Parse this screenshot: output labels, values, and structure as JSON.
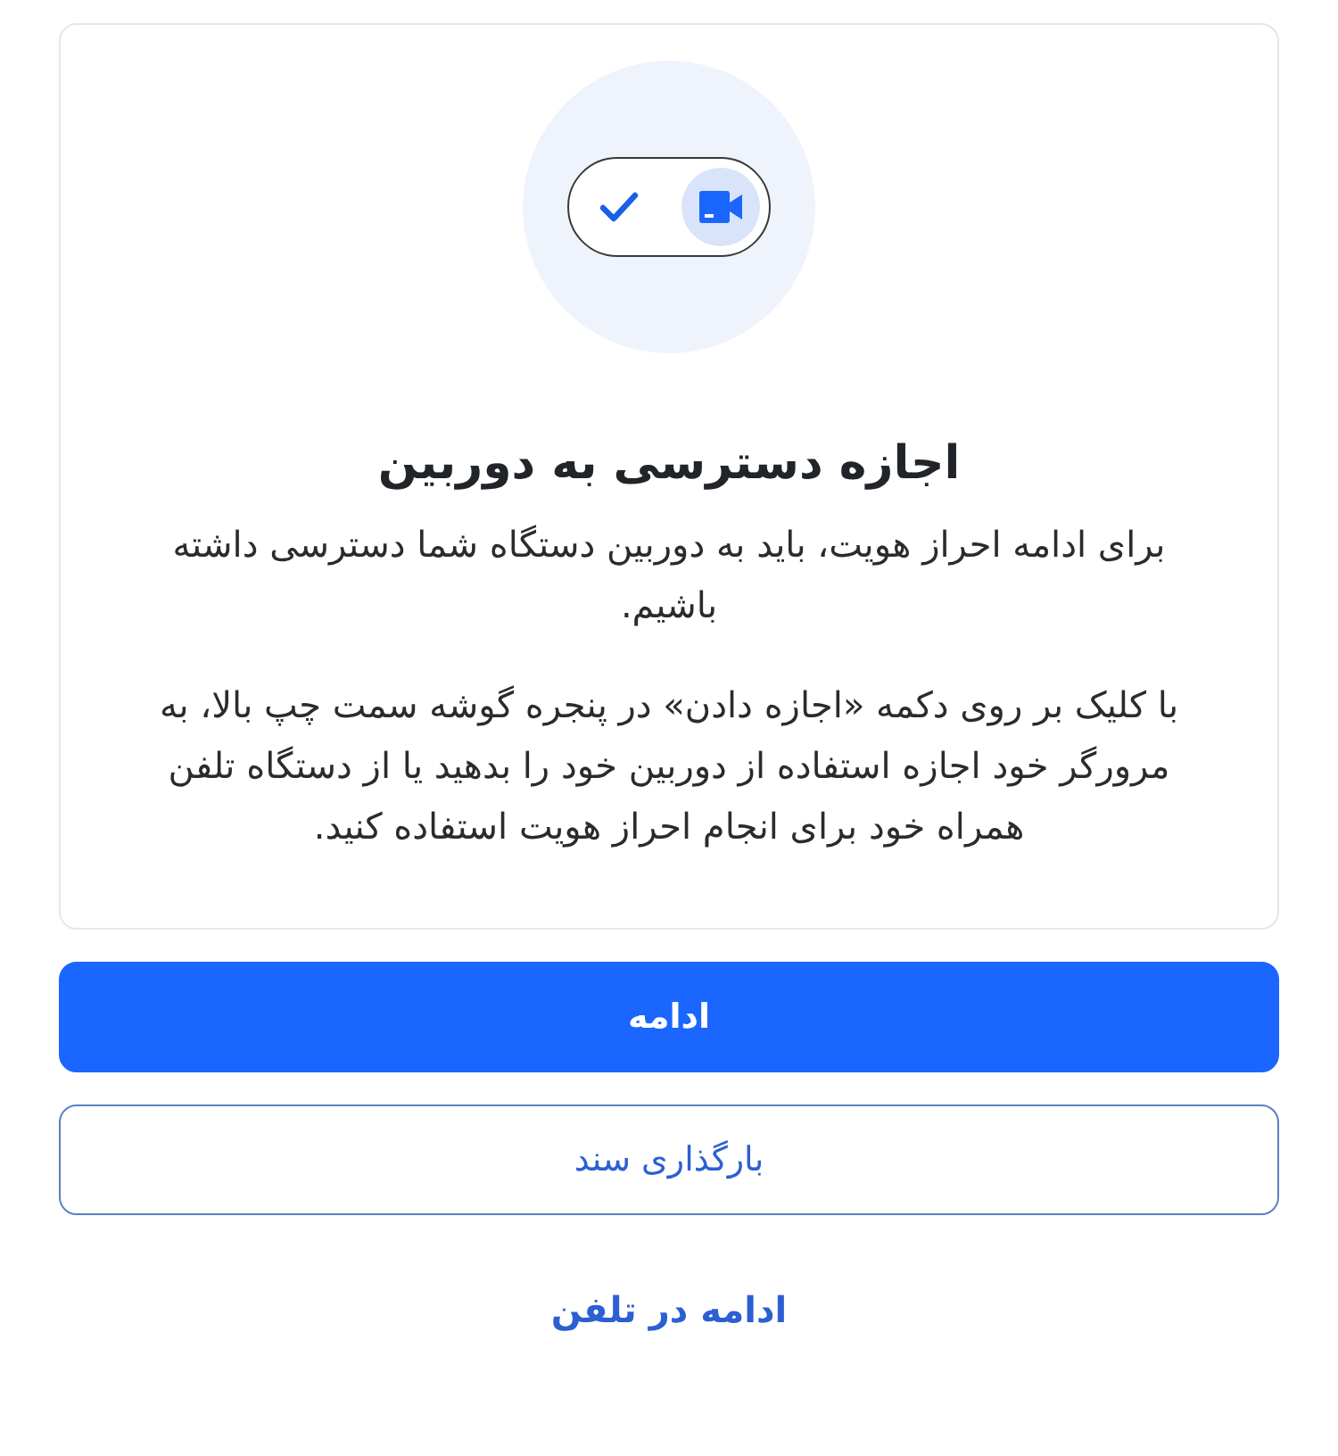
{
  "title": "اجازه دسترسی به دوربین",
  "paragraphs": [
    "برای ادامه احراز هویت، باید به دوربین دستگاه شما دسترسی داشته باشیم.",
    "با کلیک بر روی دکمه «اجازه دادن» در پنجره گوشه سمت چپ بالا، به مرورگر خود اجازه استفاده از دوربین خود را بدهید یا از دستگاه تلفن همراه خود برای انجام احراز هویت استفاده کنید."
  ],
  "buttons": [
    {
      "label": "ادامه",
      "kind": "primary"
    },
    {
      "label": "بارگذاری سند",
      "kind": "outline"
    }
  ],
  "link": "ادامه در تلفن"
}
